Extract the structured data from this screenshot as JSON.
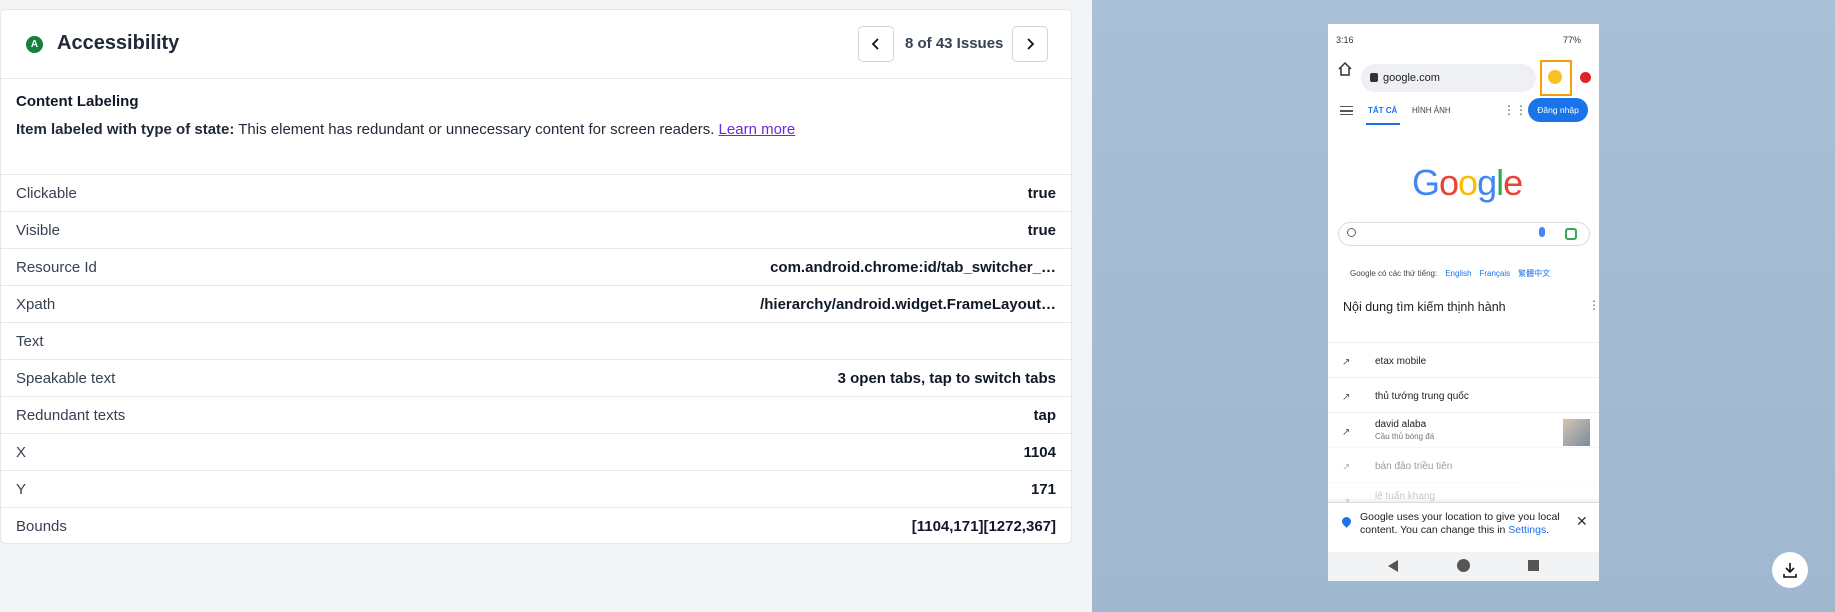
{
  "panel": {
    "badge": "A",
    "title": "Accessibility",
    "issue_count": "8 of 43 Issues"
  },
  "issue": {
    "category": "Content Labeling",
    "type_label": "Item labeled with type of state:",
    "description": " This element has redundant or unnecessary content for screen readers. ",
    "learn_more": "Learn more"
  },
  "properties": [
    {
      "key": "Clickable",
      "value": "true"
    },
    {
      "key": "Visible",
      "value": "true"
    },
    {
      "key": "Resource Id",
      "value": "com.android.chrome:id/tab_switcher_…"
    },
    {
      "key": "Xpath",
      "value": "/hierarchy/android.widget.FrameLayout…"
    },
    {
      "key": "Text",
      "value": ""
    },
    {
      "key": "Speakable text",
      "value": "3 open tabs, tap to switch tabs"
    },
    {
      "key": "Redundant texts",
      "value": "tap"
    },
    {
      "key": "X",
      "value": "1104"
    },
    {
      "key": "Y",
      "value": "171"
    },
    {
      "key": "Bounds",
      "value": "[1104,171][1272,367]"
    }
  ],
  "device": {
    "time": "3:16",
    "battery": "77%",
    "url": "google.com",
    "tab_all": "TẤT CẢ",
    "tab_images": "HÌNH ẢNH",
    "signin": "Đăng nhập",
    "logo": "Google",
    "lang_prefix": "Google có các thứ tiếng:",
    "langs": [
      "English",
      "Français",
      "繁體中文"
    ],
    "trending_heading": "Nội dung tìm kiếm thịnh hành",
    "trends": [
      {
        "label": "etax mobile",
        "sub": ""
      },
      {
        "label": "thủ tướng trung quốc",
        "sub": ""
      },
      {
        "label": "david alaba",
        "sub": "Cầu thủ bóng đá"
      },
      {
        "label": "bán đảo triều tiên",
        "sub": ""
      },
      {
        "label": "lê tuấn khang",
        "sub": ""
      }
    ],
    "toast_text": "Google uses your location to give you local content. You can change this in ",
    "toast_link": "Settings",
    "toast_end": "."
  },
  "colors": {
    "accent_purple": "#6d28d9",
    "badge_green": "#15803d",
    "highlight_orange": "#f59e0b",
    "google_blue": "#1a73e8"
  }
}
